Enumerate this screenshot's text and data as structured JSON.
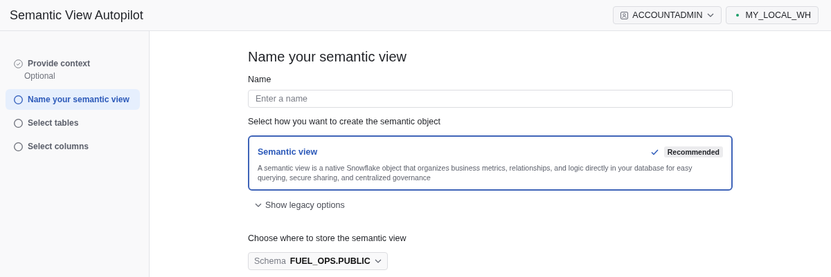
{
  "header": {
    "title": "Semantic View Autopilot",
    "role": {
      "label": "ACCOUNTADMIN"
    },
    "warehouse": {
      "label": "MY_LOCAL_WH",
      "color": "#1a9e6a"
    }
  },
  "steps": [
    {
      "label": "Provide context",
      "sublabel": "Optional",
      "done": true,
      "selected": false
    },
    {
      "label": "Name your semantic view",
      "done": false,
      "selected": true
    },
    {
      "label": "Select tables",
      "done": false,
      "selected": false
    },
    {
      "label": "Select columns",
      "done": false,
      "selected": false
    }
  ],
  "form": {
    "heading": "Name your semantic view",
    "name_label": "Name",
    "name_placeholder": "Enter a name",
    "method_label": "Select how you want to create the semantic object",
    "options": [
      {
        "title": "Semantic view",
        "badge": "Recommended",
        "description": "A semantic view is a native Snowflake object that organizes business metrics, relationships, and logic directly in your database for easy querying, secure sharing, and centralized governance",
        "selected": true
      }
    ],
    "legacy_toggle": {
      "label": "Show legacy options",
      "expanded": false
    },
    "store_label": "Choose where to store the semantic view",
    "schema": {
      "prefix": "Schema",
      "value": "FUEL_OPS.PUBLIC"
    }
  }
}
